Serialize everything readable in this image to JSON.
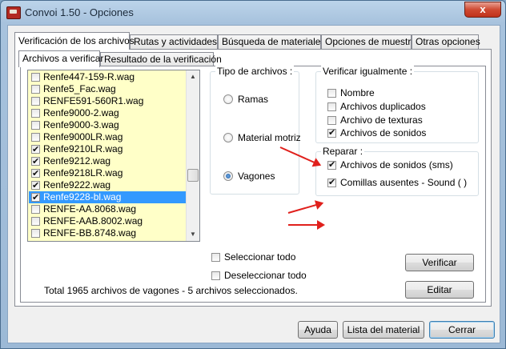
{
  "window": {
    "title": "Convoi 1.50 - Opciones",
    "close_glyph": "x"
  },
  "tabs": [
    {
      "label": "Verificación de los archivos"
    },
    {
      "label": "Rutas y actividades"
    },
    {
      "label": "Búsqueda de materiales"
    },
    {
      "label": "Opciones de muestra"
    },
    {
      "label": "Otras opciones"
    }
  ],
  "subtabs": [
    {
      "label": "Archivos a verificar"
    },
    {
      "label": "Resultado de la verificación"
    }
  ],
  "files": [
    {
      "name": "Renfe447-159-R.wag",
      "checked": false,
      "selected": false
    },
    {
      "name": "Renfe5_Fac.wag",
      "checked": false,
      "selected": false
    },
    {
      "name": "RENFE591-560R1.wag",
      "checked": false,
      "selected": false
    },
    {
      "name": "Renfe9000-2.wag",
      "checked": false,
      "selected": false
    },
    {
      "name": "Renfe9000-3.wag",
      "checked": false,
      "selected": false
    },
    {
      "name": "Renfe9000LR.wag",
      "checked": false,
      "selected": false
    },
    {
      "name": "Renfe9210LR.wag",
      "checked": true,
      "selected": false
    },
    {
      "name": "Renfe9212.wag",
      "checked": true,
      "selected": false
    },
    {
      "name": "Renfe9218LR.wag",
      "checked": true,
      "selected": false
    },
    {
      "name": "Renfe9222.wag",
      "checked": true,
      "selected": false
    },
    {
      "name": "Renfe9228-bl.wag",
      "checked": true,
      "selected": true
    },
    {
      "name": "RENFE-AA.8068.wag",
      "checked": false,
      "selected": false
    },
    {
      "name": "RENFE-AAB.8002.wag",
      "checked": false,
      "selected": false
    },
    {
      "name": "RENFE-BB.8748.wag",
      "checked": false,
      "selected": false
    }
  ],
  "tipo": {
    "title": "Tipo de archivos :",
    "options": [
      {
        "label": "Ramas",
        "on": false
      },
      {
        "label": "Material motriz",
        "on": false
      },
      {
        "label": "Vagones",
        "on": true
      }
    ]
  },
  "verificar": {
    "title": "Verificar igualmente :",
    "items": [
      {
        "label": "Nombre",
        "checked": false
      },
      {
        "label": "Archivos duplicados",
        "checked": false
      },
      {
        "label": "Archivo de texturas",
        "checked": false
      },
      {
        "label": "Archivos de sonidos",
        "checked": true
      }
    ]
  },
  "reparar": {
    "title": "Reparar :",
    "items": [
      {
        "label": "Archivos de sonidos (sms)",
        "checked": true
      },
      {
        "label": "Comillas ausentes - Sound ( )",
        "checked": true
      }
    ]
  },
  "select_all": {
    "label": "Seleccionar todo",
    "checked": false
  },
  "deselect_all": {
    "label": "Deseleccionar todo",
    "checked": false
  },
  "buttons": {
    "verificar": "Verificar",
    "editar": "Editar",
    "ayuda": "Ayuda",
    "lista": "Lista del material",
    "cerrar": "Cerrar"
  },
  "status": "Total 1965 archivos de vagones  - 5 archivos seleccionados.",
  "colors": {
    "arrow": "#e0201c",
    "list_bg": "#ffffc8",
    "selection": "#3399ff"
  }
}
